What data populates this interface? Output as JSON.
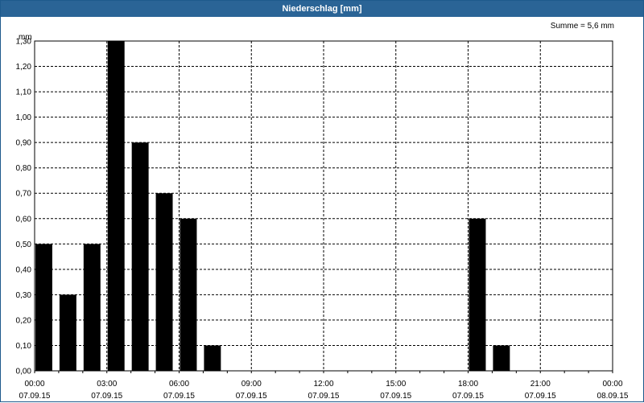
{
  "window": {
    "title": "Niederschlag [mm]"
  },
  "summary": {
    "text": "Summe = 5,6 mm"
  },
  "chart_data": {
    "type": "bar",
    "title": "Niederschlag [mm]",
    "ylabel": "mm",
    "ylim": [
      0,
      1.3
    ],
    "y_ticks": [
      "0,00",
      "0,10",
      "0,20",
      "0,30",
      "0,40",
      "0,50",
      "0,60",
      "0,70",
      "0,80",
      "0,90",
      "1,00",
      "1,10",
      "1,20",
      "1,30"
    ],
    "x_ticks": [
      {
        "time": "00:00",
        "date": "07.09.15"
      },
      {
        "time": "03:00",
        "date": "07.09.15"
      },
      {
        "time": "06:00",
        "date": "07.09.15"
      },
      {
        "time": "09:00",
        "date": "07.09.15"
      },
      {
        "time": "12:00",
        "date": "07.09.15"
      },
      {
        "time": "15:00",
        "date": "07.09.15"
      },
      {
        "time": "18:00",
        "date": "07.09.15"
      },
      {
        "time": "21:00",
        "date": "07.09.15"
      },
      {
        "time": "00:00",
        "date": "08.09.15"
      }
    ],
    "x": [
      "00:00",
      "01:00",
      "02:00",
      "03:00",
      "04:00",
      "05:00",
      "06:00",
      "07:00",
      "08:00",
      "09:00",
      "10:00",
      "11:00",
      "12:00",
      "13:00",
      "14:00",
      "15:00",
      "16:00",
      "17:00",
      "18:00",
      "19:00",
      "20:00",
      "21:00",
      "22:00",
      "23:00"
    ],
    "values": [
      0.5,
      0.3,
      0.5,
      1.3,
      0.9,
      0.7,
      0.6,
      0.1,
      0,
      0,
      0,
      0,
      0,
      0,
      0,
      0,
      0,
      0,
      0.6,
      0.1,
      0,
      0,
      0,
      0
    ],
    "grid": true,
    "bar_color": "#000000",
    "total": "5,6 mm"
  }
}
